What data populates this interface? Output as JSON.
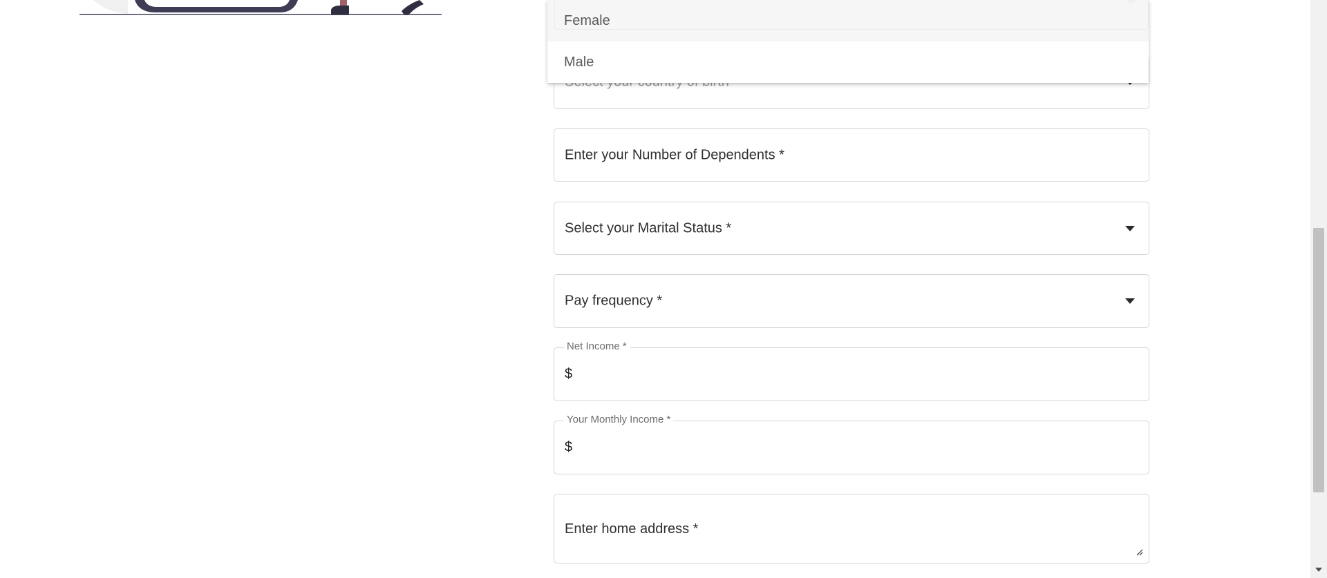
{
  "gender_menu": {
    "selected_option": "Female",
    "options": [
      "Female",
      "Male"
    ]
  },
  "form": {
    "country_of_birth_placeholder": "Select your country of birth *",
    "dependents_placeholder": "Enter your Number of Dependents *",
    "marital_status_placeholder": "Select your Marital Status *",
    "pay_frequency_placeholder": "Pay frequency *",
    "net_income_label": "Net Income *",
    "net_income_adornment": "$",
    "monthly_income_label": "Your Monthly Income *",
    "monthly_income_adornment": "$",
    "home_address_placeholder": "Enter home address *"
  },
  "colors": {
    "focus_border": "#c9a3b4",
    "field_border": "#d5d5d5",
    "illustration_dark": "#3f3d56",
    "illustration_accent": "#a0616a"
  },
  "icons": {
    "select_caret": "caret-down-icon",
    "resize_handle": "resize-handle-icon",
    "scroll_down": "arrow-down-icon"
  }
}
